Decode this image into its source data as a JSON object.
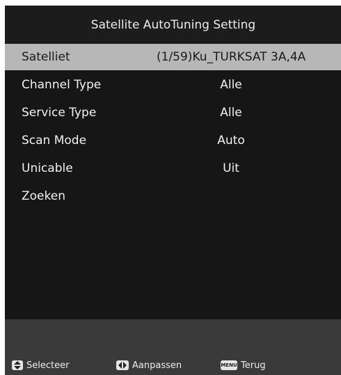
{
  "title": "Satellite AutoTuning Setting",
  "menu": {
    "items": [
      {
        "label": "Satelliet",
        "value": "(1/59)Ku_TURKSAT 3A,4A",
        "selected": true
      },
      {
        "label": "Channel Type",
        "value": "Alle",
        "selected": false
      },
      {
        "label": "Service Type",
        "value": "Alle",
        "selected": false
      },
      {
        "label": "Scan Mode",
        "value": "Auto",
        "selected": false
      },
      {
        "label": "Unicable",
        "value": "Uit",
        "selected": false
      },
      {
        "label": "Zoeken",
        "value": "",
        "selected": false
      }
    ]
  },
  "help": {
    "select_label": "Selecteer",
    "adjust_label": "Aanpassen",
    "menu_key_text": "MENU",
    "back_label": "Terug"
  },
  "icons": {
    "select": "up-down-arrows-icon",
    "adjust": "left-right-arrows-icon",
    "back": "menu-key-icon"
  },
  "colors": {
    "screen_bg": "#2c2c2c",
    "title_bg": "#1c1c1c",
    "panel_bg": "#161616",
    "selected_bg": "#b7b7b7",
    "help_bg": "#3a3a3a"
  }
}
